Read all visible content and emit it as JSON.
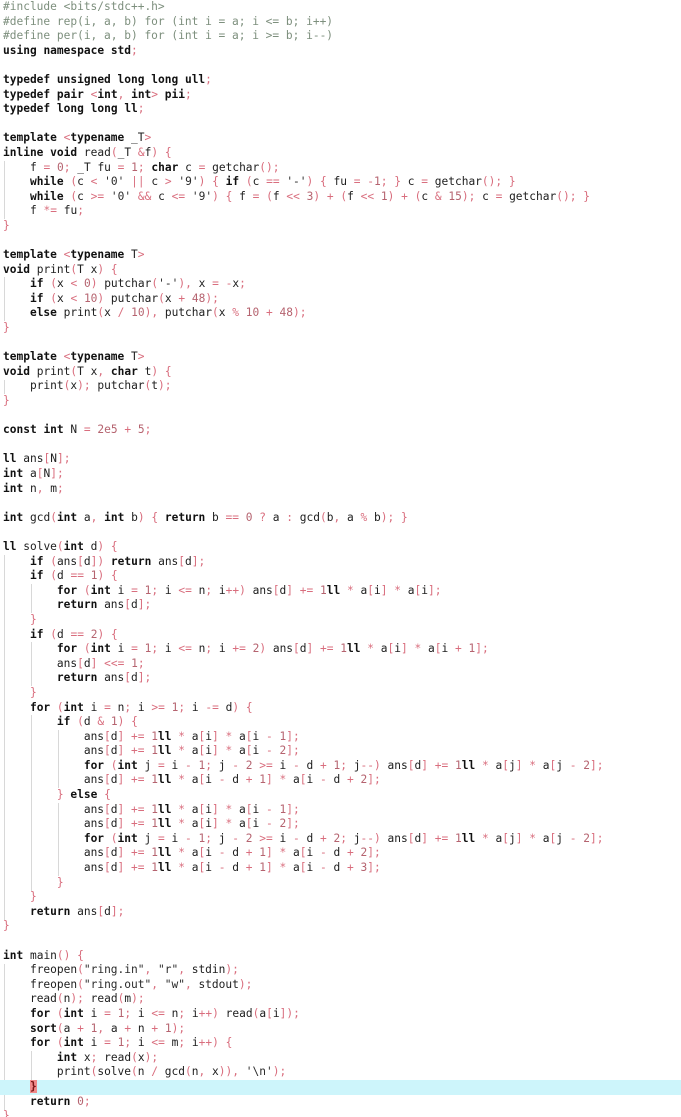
{
  "editor": {
    "language": "C++",
    "background_color": "#ffffff",
    "current_line_color": "#cdf5fb",
    "brace_highlight_color": "#f08a8a",
    "keyword_color": "#111111",
    "operator_color": "#d96e7e",
    "preprocessor_color": "#7d8f7d",
    "text_color": "#202020"
  },
  "code": {
    "lines": [
      "#include <bits/stdc++.h>",
      "#define rep(i, a, b) for (int i = a; i <= b; i++)",
      "#define per(i, a, b) for (int i = a; i >= b; i--)",
      "using namespace std;",
      "",
      "typedef unsigned long long ull;",
      "typedef pair <int, int> pii;",
      "typedef long long ll;",
      "",
      "template <typename _T>",
      "inline void read(_T &f) {",
      "    f = 0; _T fu = 1; char c = getchar();",
      "    while (c < '0' || c > '9') { if (c == '-') { fu = -1; } c = getchar(); }",
      "    while (c >= '0' && c <= '9') { f = (f << 3) + (f << 1) + (c & 15); c = getchar(); }",
      "    f *= fu;",
      "}",
      "",
      "template <typename T>",
      "void print(T x) {",
      "    if (x < 0) putchar('-'), x = -x;",
      "    if (x < 10) putchar(x + 48);",
      "    else print(x / 10), putchar(x % 10 + 48);",
      "}",
      "",
      "template <typename T>",
      "void print(T x, char t) {",
      "    print(x); putchar(t);",
      "}",
      "",
      "const int N = 2e5 + 5;",
      "",
      "ll ans[N];",
      "int a[N];",
      "int n, m;",
      "",
      "int gcd(int a, int b) { return b == 0 ? a : gcd(b, a % b); }",
      "",
      "ll solve(int d) {",
      "    if (ans[d]) return ans[d];",
      "    if (d == 1) {",
      "        for (int i = 1; i <= n; i++) ans[d] += 1ll * a[i] * a[i];",
      "        return ans[d];",
      "    }",
      "    if (d == 2) {",
      "        for (int i = 1; i <= n; i += 2) ans[d] += 1ll * a[i] * a[i + 1];",
      "        ans[d] <<= 1;",
      "        return ans[d];",
      "    }",
      "    for (int i = n; i >= 1; i -= d) {",
      "        if (d & 1) {",
      "            ans[d] += 1ll * a[i] * a[i - 1];",
      "            ans[d] += 1ll * a[i] * a[i - 2];",
      "            for (int j = i - 1; j - 2 >= i - d + 1; j--) ans[d] += 1ll * a[j] * a[j - 2];",
      "            ans[d] += 1ll * a[i - d + 1] * a[i - d + 2];",
      "        } else {",
      "            ans[d] += 1ll * a[i] * a[i - 1];",
      "            ans[d] += 1ll * a[i] * a[i - 2];",
      "            for (int j = i - 1; j - 2 >= i - d + 2; j--) ans[d] += 1ll * a[j] * a[j - 2];",
      "            ans[d] += 1ll * a[i - d + 1] * a[i - d + 2];",
      "            ans[d] += 1ll * a[i - d + 1] * a[i - d + 3];",
      "        }",
      "    }",
      "    return ans[d];",
      "}",
      "",
      "int main() {",
      "    freopen(\"ring.in\", \"r\", stdin);",
      "    freopen(\"ring.out\", \"w\", stdout);",
      "    read(n); read(m);",
      "    for (int i = 1; i <= n; i++) read(a[i]);",
      "    sort(a + 1, a + n + 1);",
      "    for (int i = 1; i <= m; i++) {",
      "        int x; read(x);",
      "        print(solve(n / gcd(n, x)), '\\n');",
      "    }",
      "    return 0;",
      "}"
    ],
    "current_line_index": 74,
    "brace_highlight_lines": [
      62,
      74
    ],
    "file_input": "ring.in",
    "file_output": "ring.out"
  }
}
